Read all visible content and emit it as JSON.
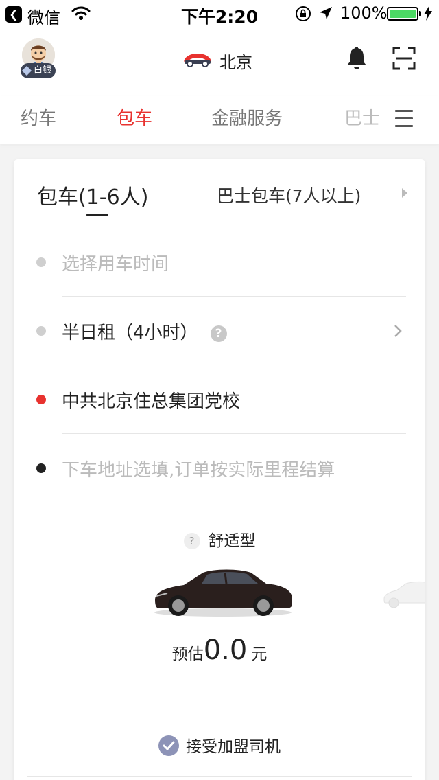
{
  "status_bar": {
    "back_app": "微信",
    "time": "下午2:20",
    "battery": "100%"
  },
  "header": {
    "member_level": "白银",
    "city": "北京"
  },
  "tabs": [
    {
      "label": "约车",
      "active": false
    },
    {
      "label": "包车",
      "active": true
    },
    {
      "label": "金融服务",
      "active": false
    },
    {
      "label": "巴士",
      "active": false
    }
  ],
  "charter": {
    "mode_main": "包车(1-6人)",
    "mode_bus": "巴士包车(7人以上)",
    "rows": [
      {
        "label": "选择用车时间",
        "placeholder": true,
        "dot_color": "#cfcfcf"
      },
      {
        "label": "半日租（4小时）",
        "placeholder": false,
        "dot_color": "#cfcfcf"
      },
      {
        "label": "中共北京住总集团党校",
        "placeholder": false,
        "dot_color": "#e8322f"
      },
      {
        "label": "下车地址选填,订单按实际里程结算",
        "placeholder": true,
        "dot_color": "#222222"
      }
    ],
    "car_type": "舒适型",
    "estimate_prefix": "预估",
    "estimate_value": "0.0",
    "estimate_unit": "元",
    "accept_driver": "接受加盟司机"
  },
  "colors": {
    "accent": "#e8322f",
    "check": "#8d93b7"
  }
}
